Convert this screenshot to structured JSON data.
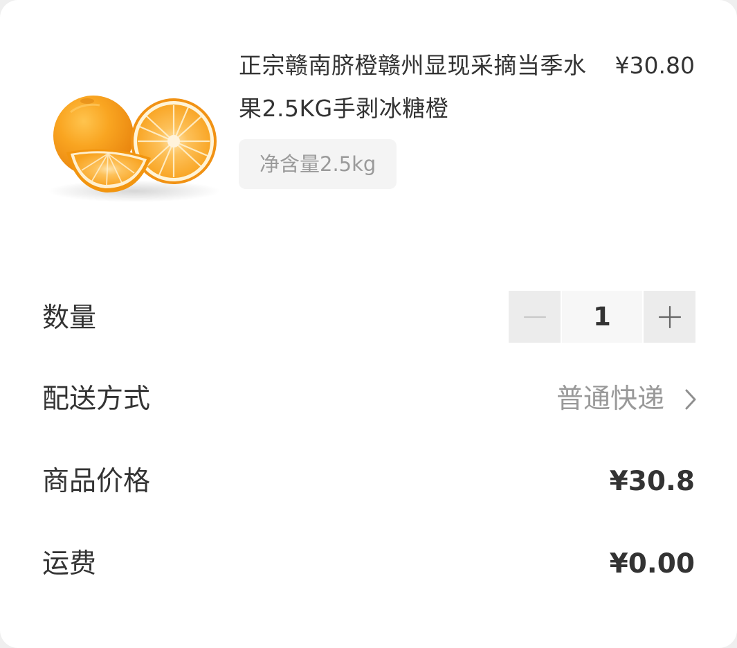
{
  "product": {
    "title": "正宗赣南脐橙赣州显现采摘当季水果2.5KG手剥冰糖橙",
    "price": "¥30.80",
    "spec": "净含量2.5kg",
    "image_alt": "orange-product-image"
  },
  "quantity": {
    "label": "数量",
    "value": "1",
    "decrement_icon": "minus-icon",
    "increment_icon": "plus-icon"
  },
  "delivery": {
    "label": "配送方式",
    "value": "普通快递",
    "icon": "chevron-right-icon"
  },
  "item_price": {
    "label": "商品价格",
    "value": "¥30.8"
  },
  "shipping": {
    "label": "运费",
    "value": "¥0.00"
  },
  "colors": {
    "primary_text": "#333333",
    "secondary_text": "#999999",
    "tag_background": "#f4f4f4",
    "stepper_background": "#ececec",
    "orange_peel": "#f6a11d",
    "orange_flesh": "#fbb846"
  }
}
